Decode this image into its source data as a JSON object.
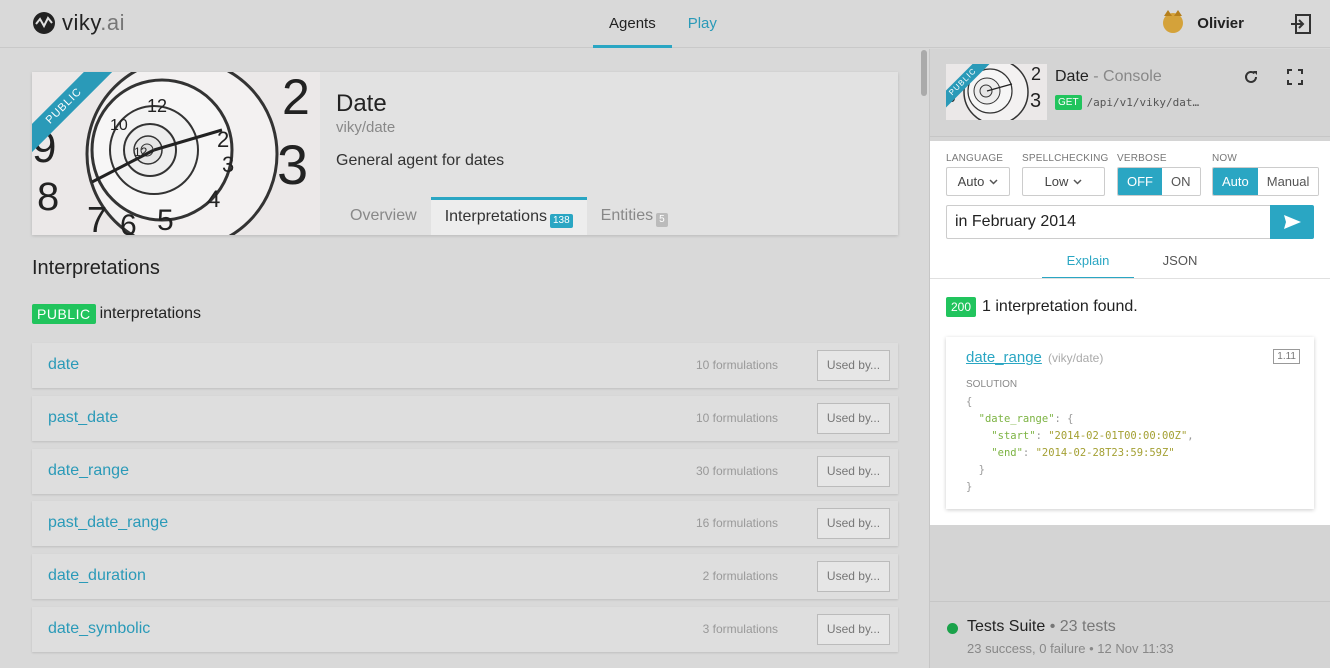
{
  "header": {
    "logo_text": "viky",
    "logo_suffix": ".ai",
    "nav": [
      {
        "label": "Agents"
      },
      {
        "label": "Play"
      }
    ],
    "user_name": "Olivier"
  },
  "agent": {
    "ribbon": "PUBLIC",
    "title": "Date",
    "slug": "viky/date",
    "description": "General agent for dates",
    "tabs": [
      {
        "label": "Overview"
      },
      {
        "label": "Interpretations",
        "count": "138"
      },
      {
        "label": "Entities",
        "count": "5"
      }
    ]
  },
  "section": {
    "title": "Interpretations",
    "public_badge": "PUBLIC",
    "public_text": "interpretations"
  },
  "interpretations": [
    {
      "name": "date",
      "count": "10 formulations",
      "button": "Used by..."
    },
    {
      "name": "past_date",
      "count": "10 formulations",
      "button": "Used by..."
    },
    {
      "name": "date_range",
      "count": "30 formulations",
      "button": "Used by..."
    },
    {
      "name": "past_date_range",
      "count": "16 formulations",
      "button": "Used by..."
    },
    {
      "name": "date_duration",
      "count": "2 formulations",
      "button": "Used by..."
    },
    {
      "name": "date_symbolic",
      "count": "3 formulations",
      "button": "Used by..."
    }
  ],
  "console": {
    "ribbon": "PUBLIC",
    "title": "Date",
    "title_suffix": " - Console",
    "method": "GET",
    "url": "/api/v1/viky/dat…",
    "options": {
      "language": {
        "label": "LANGUAGE",
        "value": "Auto"
      },
      "spellchecking": {
        "label": "SPELLCHECKING",
        "value": "Low"
      },
      "verbose": {
        "label": "VERBOSE",
        "off": "OFF",
        "on": "ON"
      },
      "now": {
        "label": "NOW",
        "auto": "Auto",
        "manual": "Manual"
      }
    },
    "query": "in February 2014",
    "subtabs": [
      {
        "label": "Explain"
      },
      {
        "label": "JSON"
      }
    ],
    "status_code": "200",
    "result_text": "1 interpretation found.",
    "result": {
      "name": "date_range",
      "slug": "(viky/date)",
      "score": "1.11",
      "solution_label": "SOLUTION",
      "json_open": "{",
      "key_date_range": "\"date_range\"",
      "key_start": "\"start\"",
      "val_start": "\"2014-02-01T00:00:00Z\"",
      "key_end": "\"end\"",
      "val_end": "\"2014-02-28T23:59:59Z\"",
      "json_close": "}"
    }
  },
  "tests": {
    "title": "Tests Suite",
    "count": "23 tests",
    "meta": "23 success, 0 failure • 12 Nov 11:33"
  },
  "colors": {
    "accent": "#2aa6c3",
    "success": "#21c45d"
  }
}
